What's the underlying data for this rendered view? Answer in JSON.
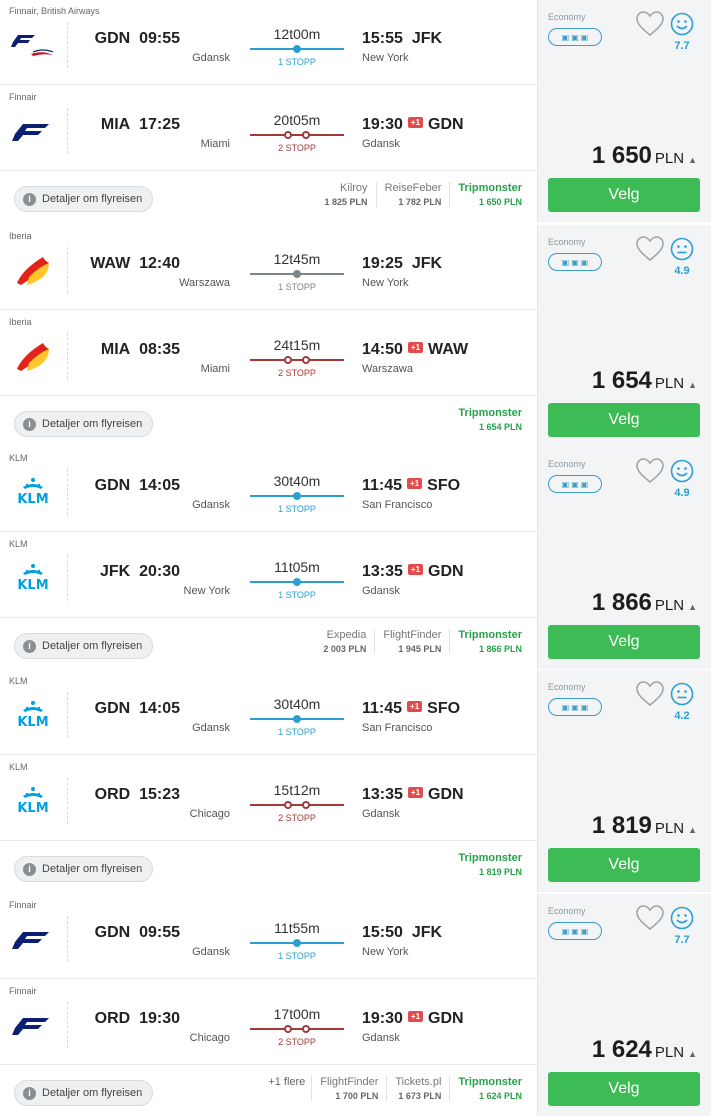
{
  "labels": {
    "details": "Detaljer om flyreisen",
    "cabin": "Economy",
    "select": "Velg",
    "currency": "PLN"
  },
  "offers": [
    {
      "price": "1 650",
      "score": "7.7",
      "mood": "happy",
      "legs": [
        {
          "airline": "Finnair, British Airways",
          "logo": "finnair-ba",
          "dep_code": "GDN",
          "dep_time": "09:55",
          "dep_city": "Gdansk",
          "duration": "12t00m",
          "stops": "1 STOPP",
          "stop_count": 1,
          "arr_time": "15:55",
          "plus": "",
          "arr_code": "JFK",
          "arr_city": "New York"
        },
        {
          "airline": "Finnair",
          "logo": "finnair",
          "dep_code": "MIA",
          "dep_time": "17:25",
          "dep_city": "Miami",
          "duration": "20t05m",
          "stops": "2 STOPP",
          "stop_count": 2,
          "arr_time": "19:30",
          "plus": "+1",
          "arr_code": "GDN",
          "arr_city": "Gdansk"
        }
      ],
      "more": "",
      "providers": [
        {
          "name": "Kilroy",
          "price": "1 825 PLN",
          "best": false
        },
        {
          "name": "ReiseFeber",
          "price": "1 782 PLN",
          "best": false
        },
        {
          "name": "Tripmonster",
          "price": "1 650 PLN",
          "best": true
        }
      ]
    },
    {
      "price": "1 654",
      "score": "4.9",
      "mood": "neutral",
      "legs": [
        {
          "airline": "Iberia",
          "logo": "iberia",
          "dep_code": "WAW",
          "dep_time": "12:40",
          "dep_city": "Warszawa",
          "duration": "12t45m",
          "stops": "1 STOPP",
          "stop_count": 1,
          "arr_time": "19:25",
          "plus": "",
          "arr_code": "JFK",
          "arr_city": "New York"
        },
        {
          "airline": "Iberia",
          "logo": "iberia",
          "dep_code": "MIA",
          "dep_time": "08:35",
          "dep_city": "Miami",
          "duration": "24t15m",
          "stops": "2 STOPP",
          "stop_count": 2,
          "arr_time": "14:50",
          "plus": "+1",
          "arr_code": "WAW",
          "arr_city": "Warszawa"
        }
      ],
      "more": "",
      "providers": [
        {
          "name": "Tripmonster",
          "price": "1 654 PLN",
          "best": true
        }
      ]
    },
    {
      "price": "1 866",
      "score": "4.9",
      "mood": "happy",
      "legs": [
        {
          "airline": "KLM",
          "logo": "klm",
          "dep_code": "GDN",
          "dep_time": "14:05",
          "dep_city": "Gdansk",
          "duration": "30t40m",
          "stops": "1 STOPP",
          "stop_count": 1,
          "arr_time": "11:45",
          "plus": "+1",
          "arr_code": "SFO",
          "arr_city": "San Francisco"
        },
        {
          "airline": "KLM",
          "logo": "klm",
          "dep_code": "JFK",
          "dep_time": "20:30",
          "dep_city": "New York",
          "duration": "11t05m",
          "stops": "1 STOPP",
          "stop_count": 1,
          "arr_time": "13:35",
          "plus": "+1",
          "arr_code": "GDN",
          "arr_city": "Gdansk"
        }
      ],
      "more": "",
      "providers": [
        {
          "name": "Expedia",
          "price": "2 003 PLN",
          "best": false
        },
        {
          "name": "FlightFinder",
          "price": "1 945 PLN",
          "best": false
        },
        {
          "name": "Tripmonster",
          "price": "1 866 PLN",
          "best": true
        }
      ]
    },
    {
      "price": "1 819",
      "score": "4.2",
      "mood": "neutral",
      "legs": [
        {
          "airline": "KLM",
          "logo": "klm",
          "dep_code": "GDN",
          "dep_time": "14:05",
          "dep_city": "Gdansk",
          "duration": "30t40m",
          "stops": "1 STOPP",
          "stop_count": 1,
          "arr_time": "11:45",
          "plus": "+1",
          "arr_code": "SFO",
          "arr_city": "San Francisco"
        },
        {
          "airline": "KLM",
          "logo": "klm",
          "dep_code": "ORD",
          "dep_time": "15:23",
          "dep_city": "Chicago",
          "duration": "15t12m",
          "stops": "2 STOPP",
          "stop_count": 2,
          "arr_time": "13:35",
          "plus": "+1",
          "arr_code": "GDN",
          "arr_city": "Gdansk"
        }
      ],
      "more": "",
      "providers": [
        {
          "name": "Tripmonster",
          "price": "1 819 PLN",
          "best": true
        }
      ]
    },
    {
      "price": "1 624",
      "score": "7.7",
      "mood": "happy",
      "legs": [
        {
          "airline": "Finnair",
          "logo": "finnair",
          "dep_code": "GDN",
          "dep_time": "09:55",
          "dep_city": "Gdansk",
          "duration": "11t55m",
          "stops": "1 STOPP",
          "stop_count": 1,
          "arr_time": "15:50",
          "plus": "",
          "arr_code": "JFK",
          "arr_city": "New York"
        },
        {
          "airline": "Finnair",
          "logo": "finnair",
          "dep_code": "ORD",
          "dep_time": "19:30",
          "dep_city": "Chicago",
          "duration": "17t00m",
          "stops": "2 STOPP",
          "stop_count": 2,
          "arr_time": "19:30",
          "plus": "+1",
          "arr_code": "GDN",
          "arr_city": "Gdansk"
        }
      ],
      "more": "+1 flere",
      "providers": [
        {
          "name": "FlightFinder",
          "price": "1 700 PLN",
          "best": false
        },
        {
          "name": "Tickets.pl",
          "price": "1 673 PLN",
          "best": false
        },
        {
          "name": "Tripmonster",
          "price": "1 624 PLN",
          "best": true
        }
      ]
    }
  ],
  "colors": {
    "one_stop": "#2a9fd0",
    "two_stop": "#a23a3a",
    "one_stop_grey": "#7d8488",
    "best_provider": "#27a24a",
    "select_button": "#3dbb55",
    "score": "#2a9fd0"
  }
}
